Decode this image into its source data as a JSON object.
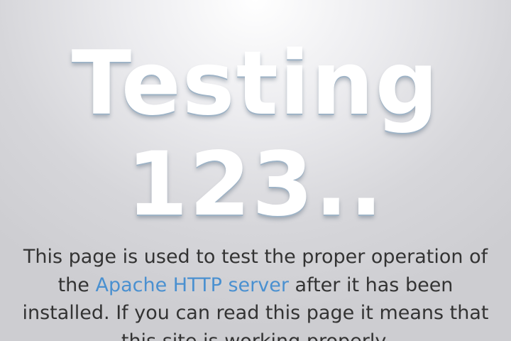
{
  "hero": {
    "line1": "Testing",
    "line2": "123.."
  },
  "intro": {
    "text_before_link": "This page is used to test the proper operation of the ",
    "link_text": "Apache HTTP server",
    "text_after_link": " after it has been installed. If you can read this page it means that this site is working properly."
  },
  "colors": {
    "hero_text": "#ffffff",
    "body_text": "#333333",
    "link": "#4a90d0"
  }
}
